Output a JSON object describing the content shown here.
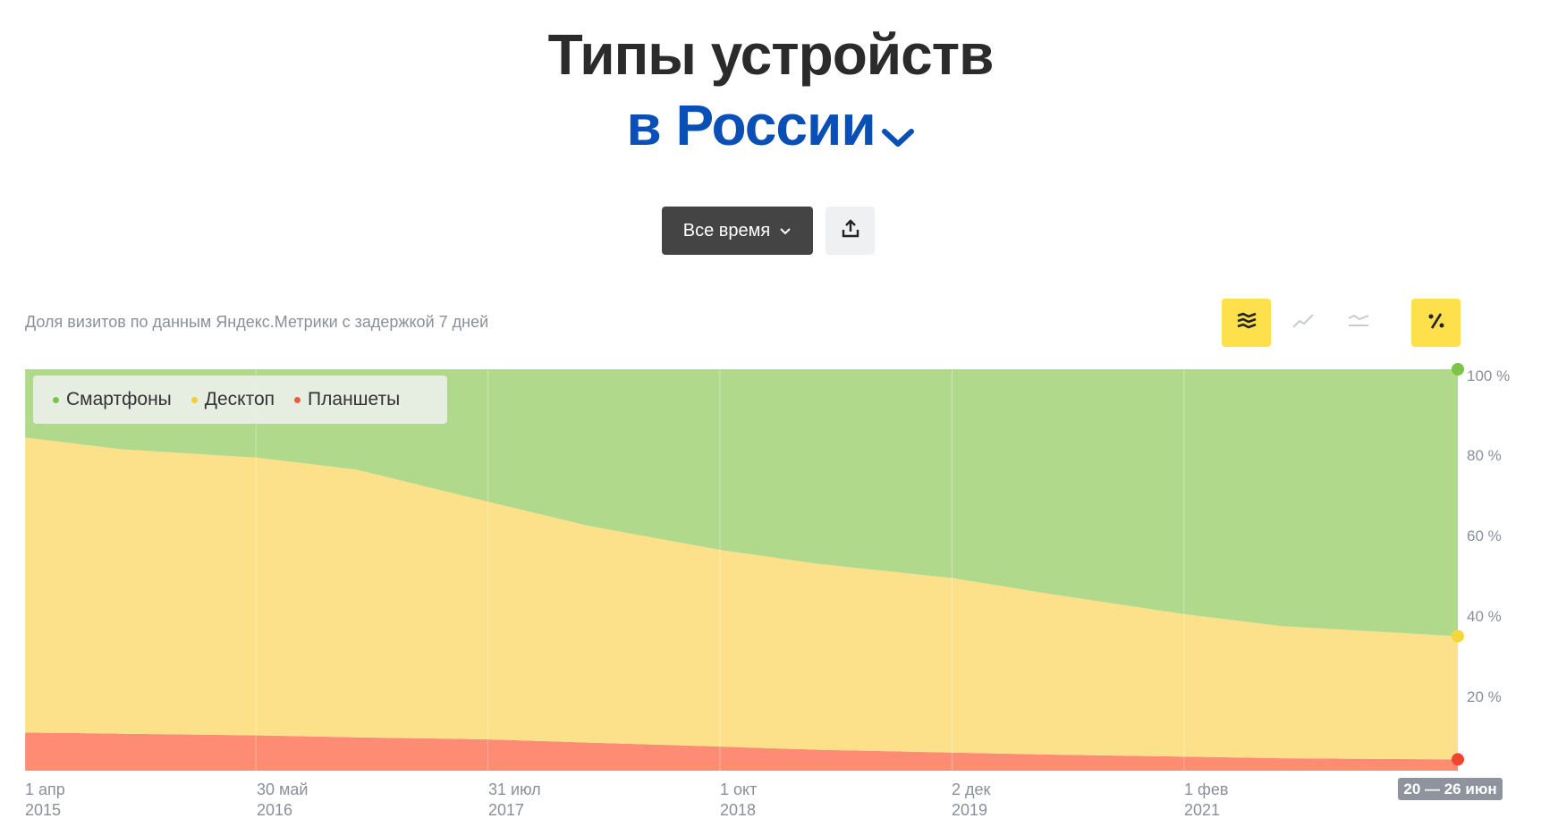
{
  "header": {
    "title": "Типы устройств",
    "region": "в России"
  },
  "controls": {
    "period_label": "Все время"
  },
  "subtitle": "Доля визитов по данным Яндекс.Метрики с задержкой 7 дней",
  "colors": {
    "smartphones": "#b1d98b",
    "desktop": "#fde18a",
    "tablets": "#fe8b74",
    "region": "#0a4fb5",
    "accent": "#fde04b"
  },
  "icons": {
    "stacked": "stacked-area-icon",
    "line": "line-chart-icon",
    "compare": "compare-lines-icon",
    "percent": "percent-icon",
    "share": "share-icon"
  },
  "range_badge": "20 — 26 июн",
  "chart_data": {
    "type": "area",
    "stacked": true,
    "normalized_percent": true,
    "x": [
      "2015-04-01",
      "2015-10-01",
      "2016-05-30",
      "2016-12-01",
      "2017-07-31",
      "2018-02-01",
      "2018-10-01",
      "2019-04-01",
      "2019-12-02",
      "2020-06-01",
      "2021-02-01",
      "2021-08-01",
      "2022-06-20"
    ],
    "x_tick_labels": [
      {
        "date": "2015-04-01",
        "day": "1 апр",
        "year": "2015"
      },
      {
        "date": "2016-05-30",
        "day": "30 май",
        "year": "2016"
      },
      {
        "date": "2017-07-31",
        "day": "31 июл",
        "year": "2017"
      },
      {
        "date": "2018-10-01",
        "day": "1 окт",
        "year": "2018"
      },
      {
        "date": "2019-12-02",
        "day": "2 дек",
        "year": "2019"
      },
      {
        "date": "2021-02-01",
        "day": "1 фев",
        "year": "2021"
      }
    ],
    "y_ticks": [
      "20 %",
      "40 %",
      "60 %",
      "80 %",
      "100 %"
    ],
    "ylim": [
      0,
      100
    ],
    "legend_position": "top-left",
    "series": [
      {
        "name": "Планшеты",
        "values": [
          9.5,
          9.2,
          8.8,
          8.3,
          7.8,
          7.0,
          6.0,
          5.2,
          4.5,
          4.0,
          3.5,
          3.1,
          2.8
        ]
      },
      {
        "name": "Десктоп",
        "values": [
          73.5,
          70.8,
          69.2,
          66.7,
          59.2,
          54.0,
          49.0,
          46.3,
          43.5,
          40.0,
          35.5,
          32.9,
          30.7
        ]
      },
      {
        "name": "Смартфоны",
        "values": [
          17.0,
          20.0,
          22.0,
          25.0,
          33.0,
          39.0,
          45.0,
          48.5,
          52.0,
          56.0,
          61.0,
          64.0,
          66.5
        ]
      }
    ]
  }
}
